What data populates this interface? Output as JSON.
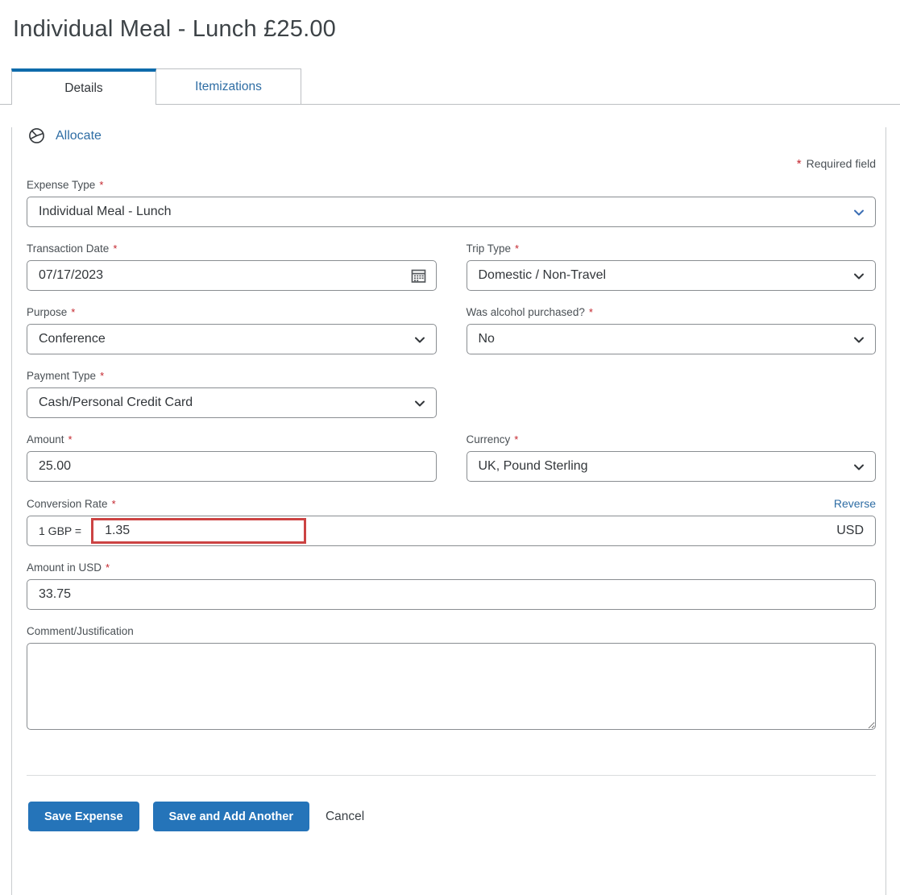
{
  "page": {
    "title": "Individual Meal - Lunch £25.00"
  },
  "tabs": [
    {
      "label": "Details",
      "active": true
    },
    {
      "label": "Itemizations",
      "active": false
    }
  ],
  "toolbar": {
    "allocate_label": "Allocate"
  },
  "marks": {
    "required": "*"
  },
  "required_note": {
    "text": "Required field"
  },
  "fields": {
    "expense_type": {
      "label": "Expense Type",
      "value": "Individual Meal - Lunch",
      "required": true
    },
    "transaction_date": {
      "label": "Transaction Date",
      "value": "07/17/2023",
      "required": true
    },
    "trip_type": {
      "label": "Trip Type",
      "value": "Domestic / Non-Travel",
      "required": true
    },
    "purpose": {
      "label": "Purpose",
      "value": "Conference",
      "required": true
    },
    "alcohol": {
      "label": "Was alcohol purchased?",
      "value": "No",
      "required": true
    },
    "payment_type": {
      "label": "Payment Type",
      "value": "Cash/Personal Credit Card",
      "required": true
    },
    "amount": {
      "label": "Amount",
      "value": "25.00",
      "required": true
    },
    "currency": {
      "label": "Currency",
      "value": "UK, Pound Sterling",
      "required": true
    },
    "conversion_rate": {
      "label": "Conversion Rate",
      "prefix": "1 GBP =",
      "value": "1.35",
      "suffix": "USD",
      "reverse_label": "Reverse",
      "required": true
    },
    "amount_usd": {
      "label": "Amount in USD",
      "value": "33.75",
      "required": true
    },
    "comment": {
      "label": "Comment/Justification",
      "value": ""
    }
  },
  "buttons": {
    "save": "Save Expense",
    "save_add": "Save and Add Another",
    "cancel": "Cancel"
  },
  "colors": {
    "accent_blue": "#2e6da4",
    "tab_active_border": "#0e6bab",
    "button_blue": "#2574b9",
    "highlight_red": "#cc4343",
    "asterisk_red": "#c4262e"
  }
}
